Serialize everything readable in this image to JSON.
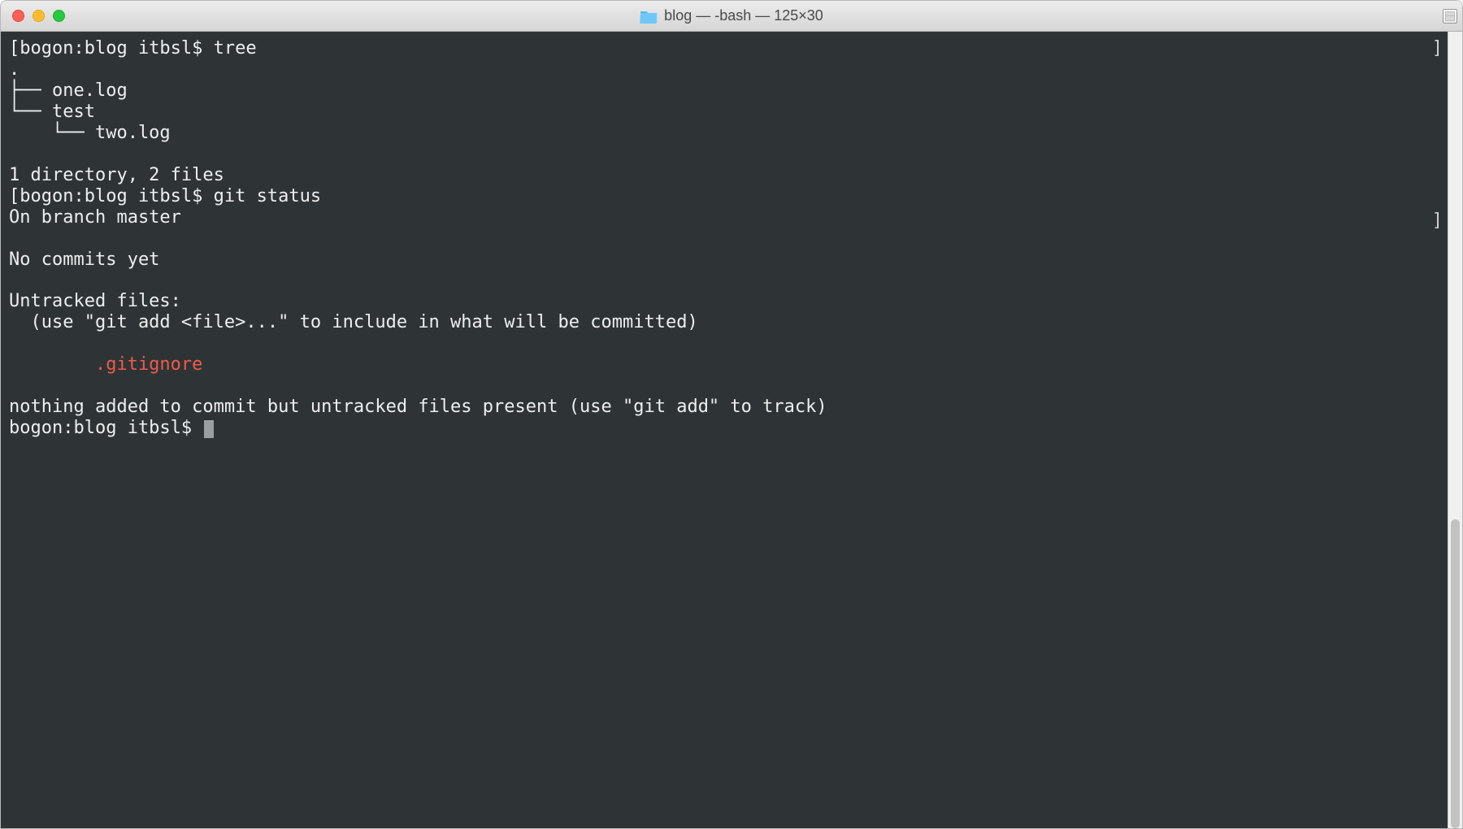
{
  "window": {
    "title": "blog — -bash — 125×30"
  },
  "terminal": {
    "prompt1_left": "[bogon:blog itbsl$ ",
    "cmd1": "tree",
    "tree_dot": ".",
    "tree_l1": "├── one.log",
    "tree_l2": "└── test",
    "tree_l3": "    └── two.log",
    "tree_summary": "1 directory, 2 files",
    "prompt2_left": "[bogon:blog itbsl$ ",
    "cmd2": "git status",
    "git_branch": "On branch master",
    "git_no_commits": "No commits yet",
    "git_untracked_hdr": "Untracked files:",
    "git_untracked_hint": "  (use \"git add <file>...\" to include in what will be committed)",
    "git_untracked_file": "        .gitignore",
    "git_nothing": "nothing added to commit but untracked files present (use \"git add\" to track)",
    "prompt3": "bogon:blog itbsl$ ",
    "bracket": "]"
  }
}
